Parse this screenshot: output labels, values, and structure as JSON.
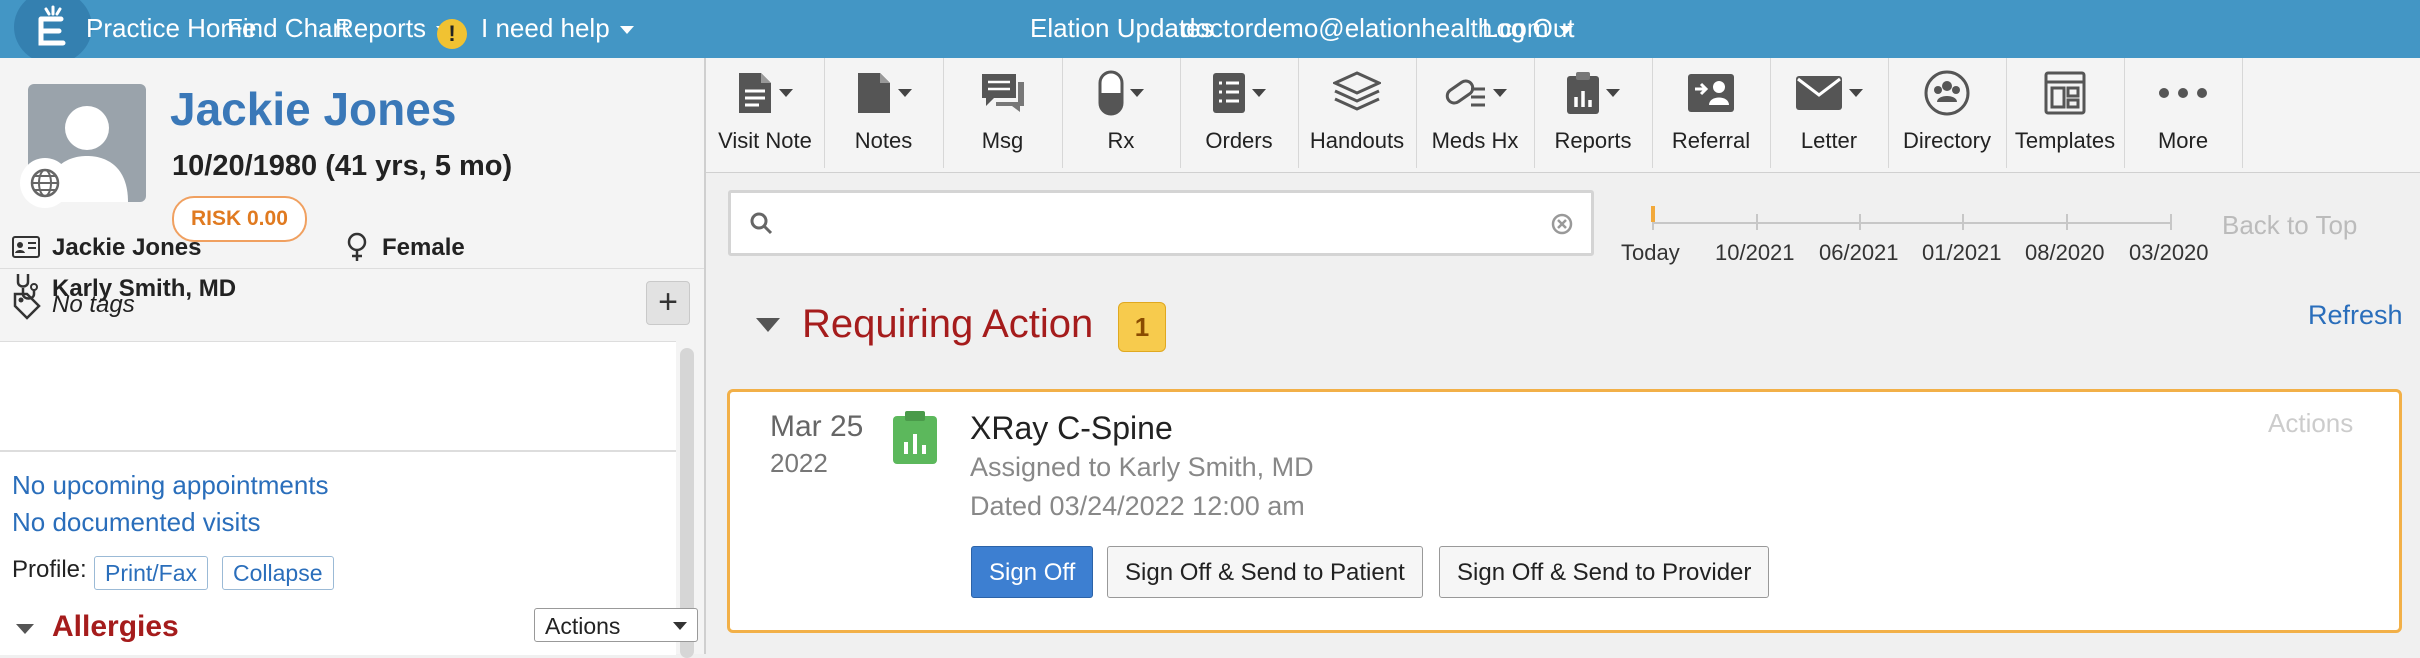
{
  "nav": {
    "items": [
      "Practice Home",
      "Find Chart",
      "Reports",
      "I need help"
    ],
    "right_items": [
      "Elation Updates",
      "doctordemo@elationhealth.com",
      "Log Out"
    ]
  },
  "patient": {
    "name": "Jackie Jones",
    "dob": "10/20/1980 (41 yrs, 5 mo)",
    "risk": "RISK 0.00",
    "tags": "No tags",
    "display_name": "Jackie Jones",
    "sex": "Female",
    "provider": "Karly Smith, MD",
    "upcoming": "No upcoming appointments",
    "visits": "No documented visits",
    "profile_label": "Profile:",
    "print_fax": "Print/Fax",
    "collapse": "Collapse",
    "allergies": "Allergies",
    "actions": "Actions"
  },
  "toolbar": [
    {
      "label": "Visit Note",
      "icon": "visit-note-icon"
    },
    {
      "label": "Notes",
      "icon": "notes-icon"
    },
    {
      "label": "Msg",
      "icon": "message-icon"
    },
    {
      "label": "Rx",
      "icon": "rx-icon"
    },
    {
      "label": "Orders",
      "icon": "orders-icon"
    },
    {
      "label": "Handouts",
      "icon": "handouts-icon"
    },
    {
      "label": "Meds Hx",
      "icon": "meds-hx-icon"
    },
    {
      "label": "Reports",
      "icon": "reports-icon"
    },
    {
      "label": "Referral",
      "icon": "referral-icon"
    },
    {
      "label": "Letter",
      "icon": "letter-icon"
    },
    {
      "label": "Directory",
      "icon": "directory-icon"
    },
    {
      "label": "Templates",
      "icon": "templates-icon"
    },
    {
      "label": "More",
      "icon": "more-icon"
    }
  ],
  "timeline": {
    "labels": [
      "Today",
      "10/2021",
      "06/2021",
      "01/2021",
      "08/2020",
      "03/2020"
    ],
    "back_to_top": "Back to Top"
  },
  "requiring_action": {
    "title": "Requiring Action",
    "count": "1",
    "refresh": "Refresh",
    "item": {
      "month": "Mar 25",
      "year": "2022",
      "title": "XRay C-Spine",
      "assigned": "Assigned to Karly Smith, MD",
      "dated": "Dated 03/24/2022 12:00 am",
      "actions": "Actions",
      "buttons": [
        "Sign Off",
        "Sign Off & Send to Patient",
        "Sign Off & Send to Provider"
      ]
    }
  },
  "colors": {
    "nav_bg": "#4396c5",
    "patient_name": "#3a78b8",
    "section_title": "#a51c1c",
    "primary_button": "#3d7fd1",
    "card_border": "#f2b048"
  }
}
